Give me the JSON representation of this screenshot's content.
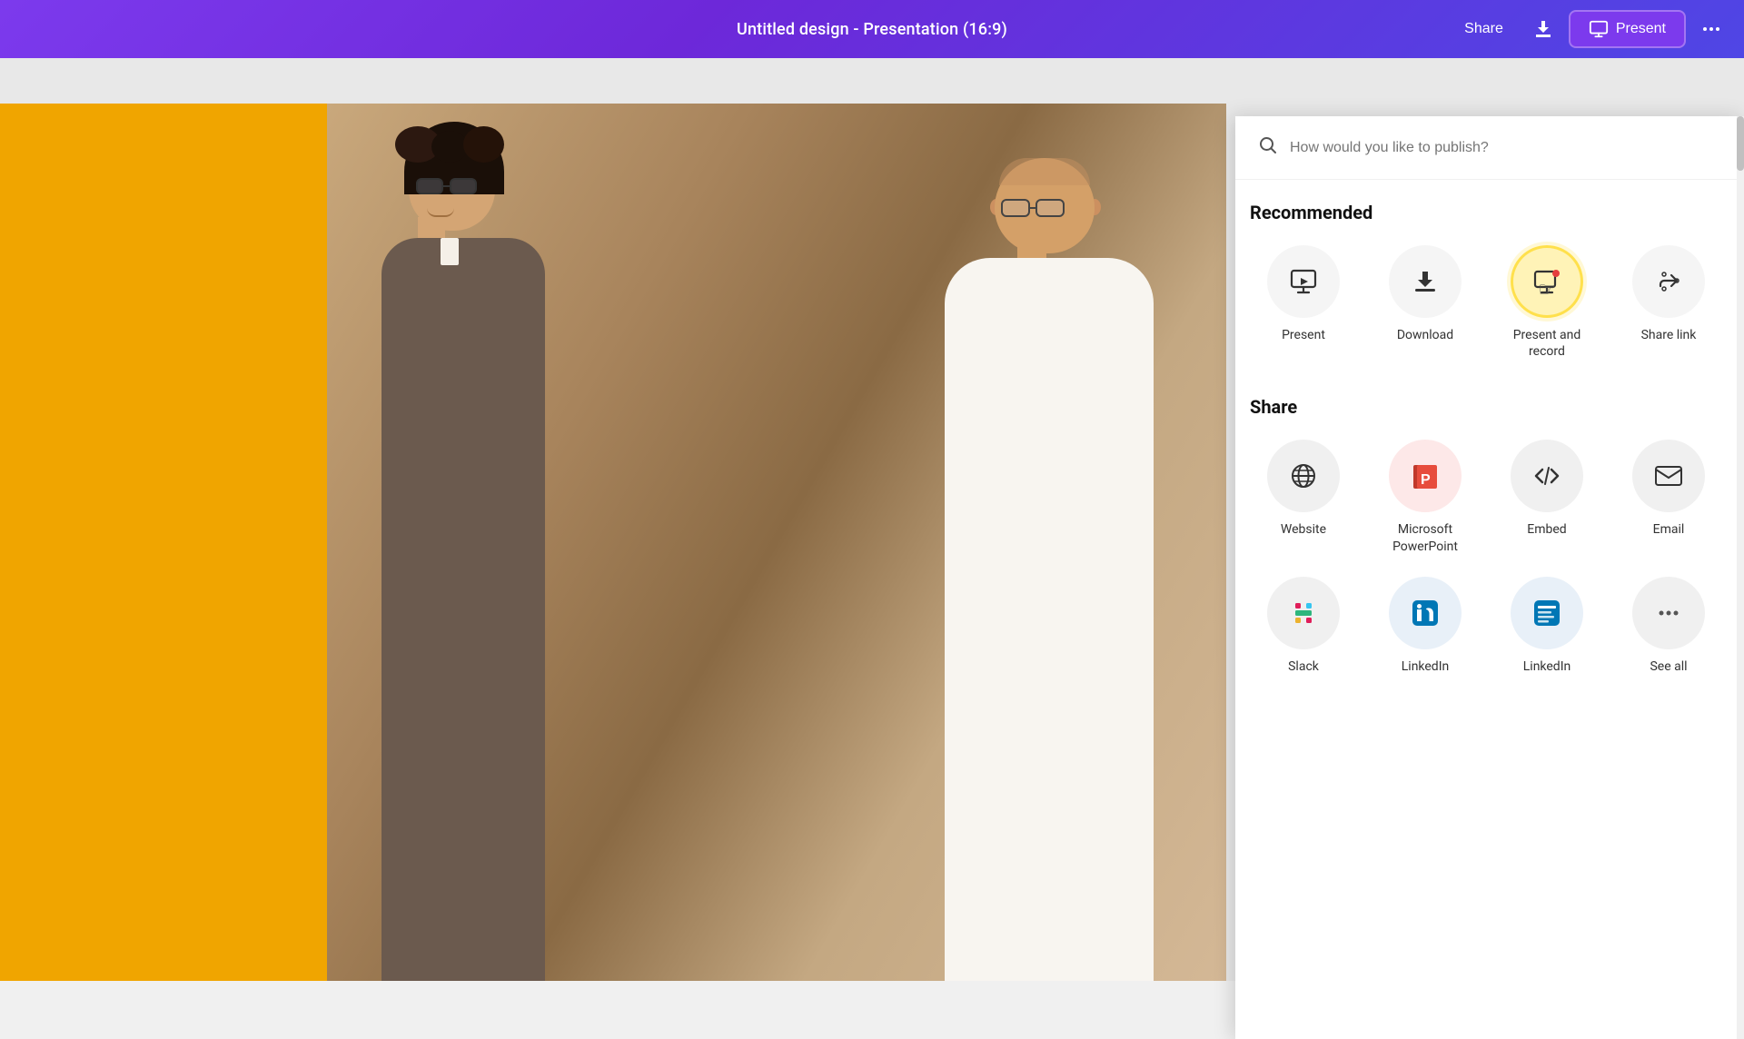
{
  "header": {
    "title": "Untitled design - Presentation (16:9)",
    "share_label": "Share",
    "present_label": "Present",
    "more_dots": "•••"
  },
  "panel": {
    "search_placeholder": "How would you like to publish?",
    "recommended_title": "Recommended",
    "share_title": "Share",
    "items_recommended": [
      {
        "id": "present",
        "label": "Present",
        "highlighted": false
      },
      {
        "id": "download",
        "label": "Download",
        "highlighted": false
      },
      {
        "id": "present-record",
        "label": "Present and record",
        "highlighted": true
      },
      {
        "id": "share-link",
        "label": "Share link",
        "highlighted": false
      }
    ],
    "items_share": [
      {
        "id": "website",
        "label": "Website"
      },
      {
        "id": "microsoft-ppt",
        "label": "Microsoft PowerPoint"
      },
      {
        "id": "embed",
        "label": "Embed"
      },
      {
        "id": "email",
        "label": "Email"
      },
      {
        "id": "slack",
        "label": "Slack"
      },
      {
        "id": "linkedin",
        "label": "LinkedIn"
      },
      {
        "id": "linkedin2",
        "label": "LinkedIn"
      },
      {
        "id": "see-all",
        "label": "See all"
      }
    ]
  }
}
